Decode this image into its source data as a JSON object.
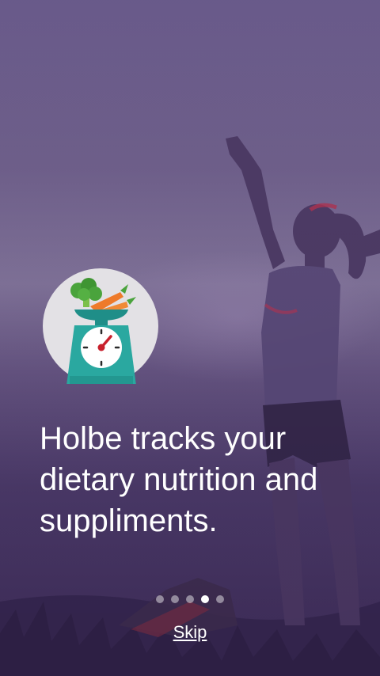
{
  "onboarding": {
    "headline": "Holbe tracks your dietary nutrition and suppliments.",
    "illustration_icon": "kitchen-scale-with-vegetables-icon",
    "pagination": {
      "total": 5,
      "active_index": 3
    },
    "skip_label": "Skip"
  },
  "colors": {
    "background_top": "#6d5f8d",
    "background_bottom": "#3a2a52",
    "icon_circle": "#e3e1e5",
    "scale_body": "#2aa8a0",
    "carrot": "#ee7a2a",
    "broccoli": "#4aa33c",
    "needle": "#c8202c",
    "text": "#ffffff"
  }
}
